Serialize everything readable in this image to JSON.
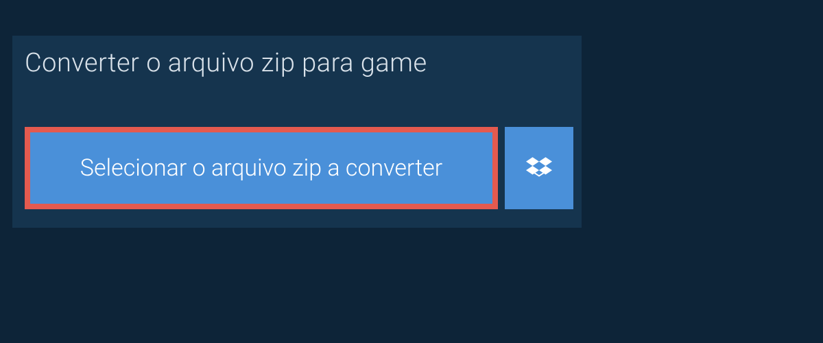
{
  "header": {
    "title": "Converter o arquivo zip para game"
  },
  "buttons": {
    "select_file_label": "Selecionar o arquivo zip a converter"
  }
}
